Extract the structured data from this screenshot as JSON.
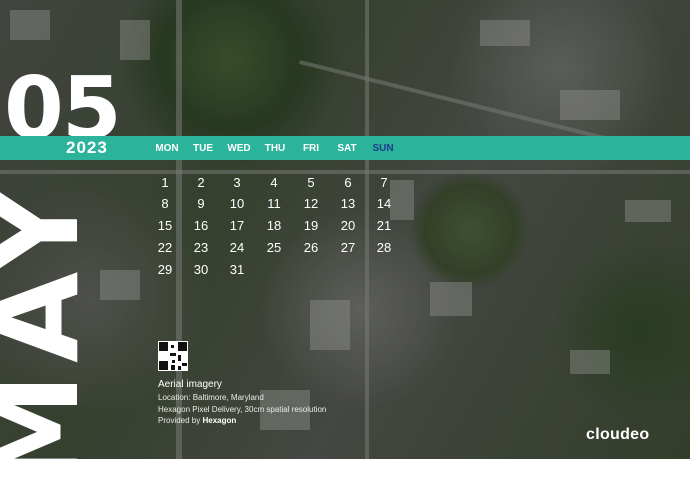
{
  "calendar": {
    "day_number": "05",
    "year": "2023",
    "month": "MAY",
    "weekdays": [
      "MON",
      "TUE",
      "WED",
      "THU",
      "FRI",
      "SAT",
      "SUN"
    ],
    "dates": [
      [
        "1",
        "2",
        "3",
        "4",
        "5",
        "6",
        "7"
      ],
      [
        "8",
        "9",
        "10",
        "11",
        "12",
        "13",
        "14"
      ],
      [
        "15",
        "16",
        "17",
        "18",
        "19",
        "20",
        "21"
      ],
      [
        "22",
        "23",
        "24",
        "25",
        "26",
        "27",
        "28"
      ],
      [
        "29",
        "30",
        "31"
      ]
    ]
  },
  "caption": {
    "title": "Aerial imagery",
    "location": "Location: Baltimore, Maryland",
    "delivery": "Hexagon Pixel Delivery, 30cm spatial resolution",
    "provided_prefix": "Provided by",
    "provided_by": "Hexagon"
  },
  "brand": "cloudeo",
  "colors": {
    "accent_band": "#2bb39c",
    "sunday_label": "#1f3c8a",
    "text": "#ffffff"
  },
  "icons": [
    "qr-code-icon"
  ]
}
